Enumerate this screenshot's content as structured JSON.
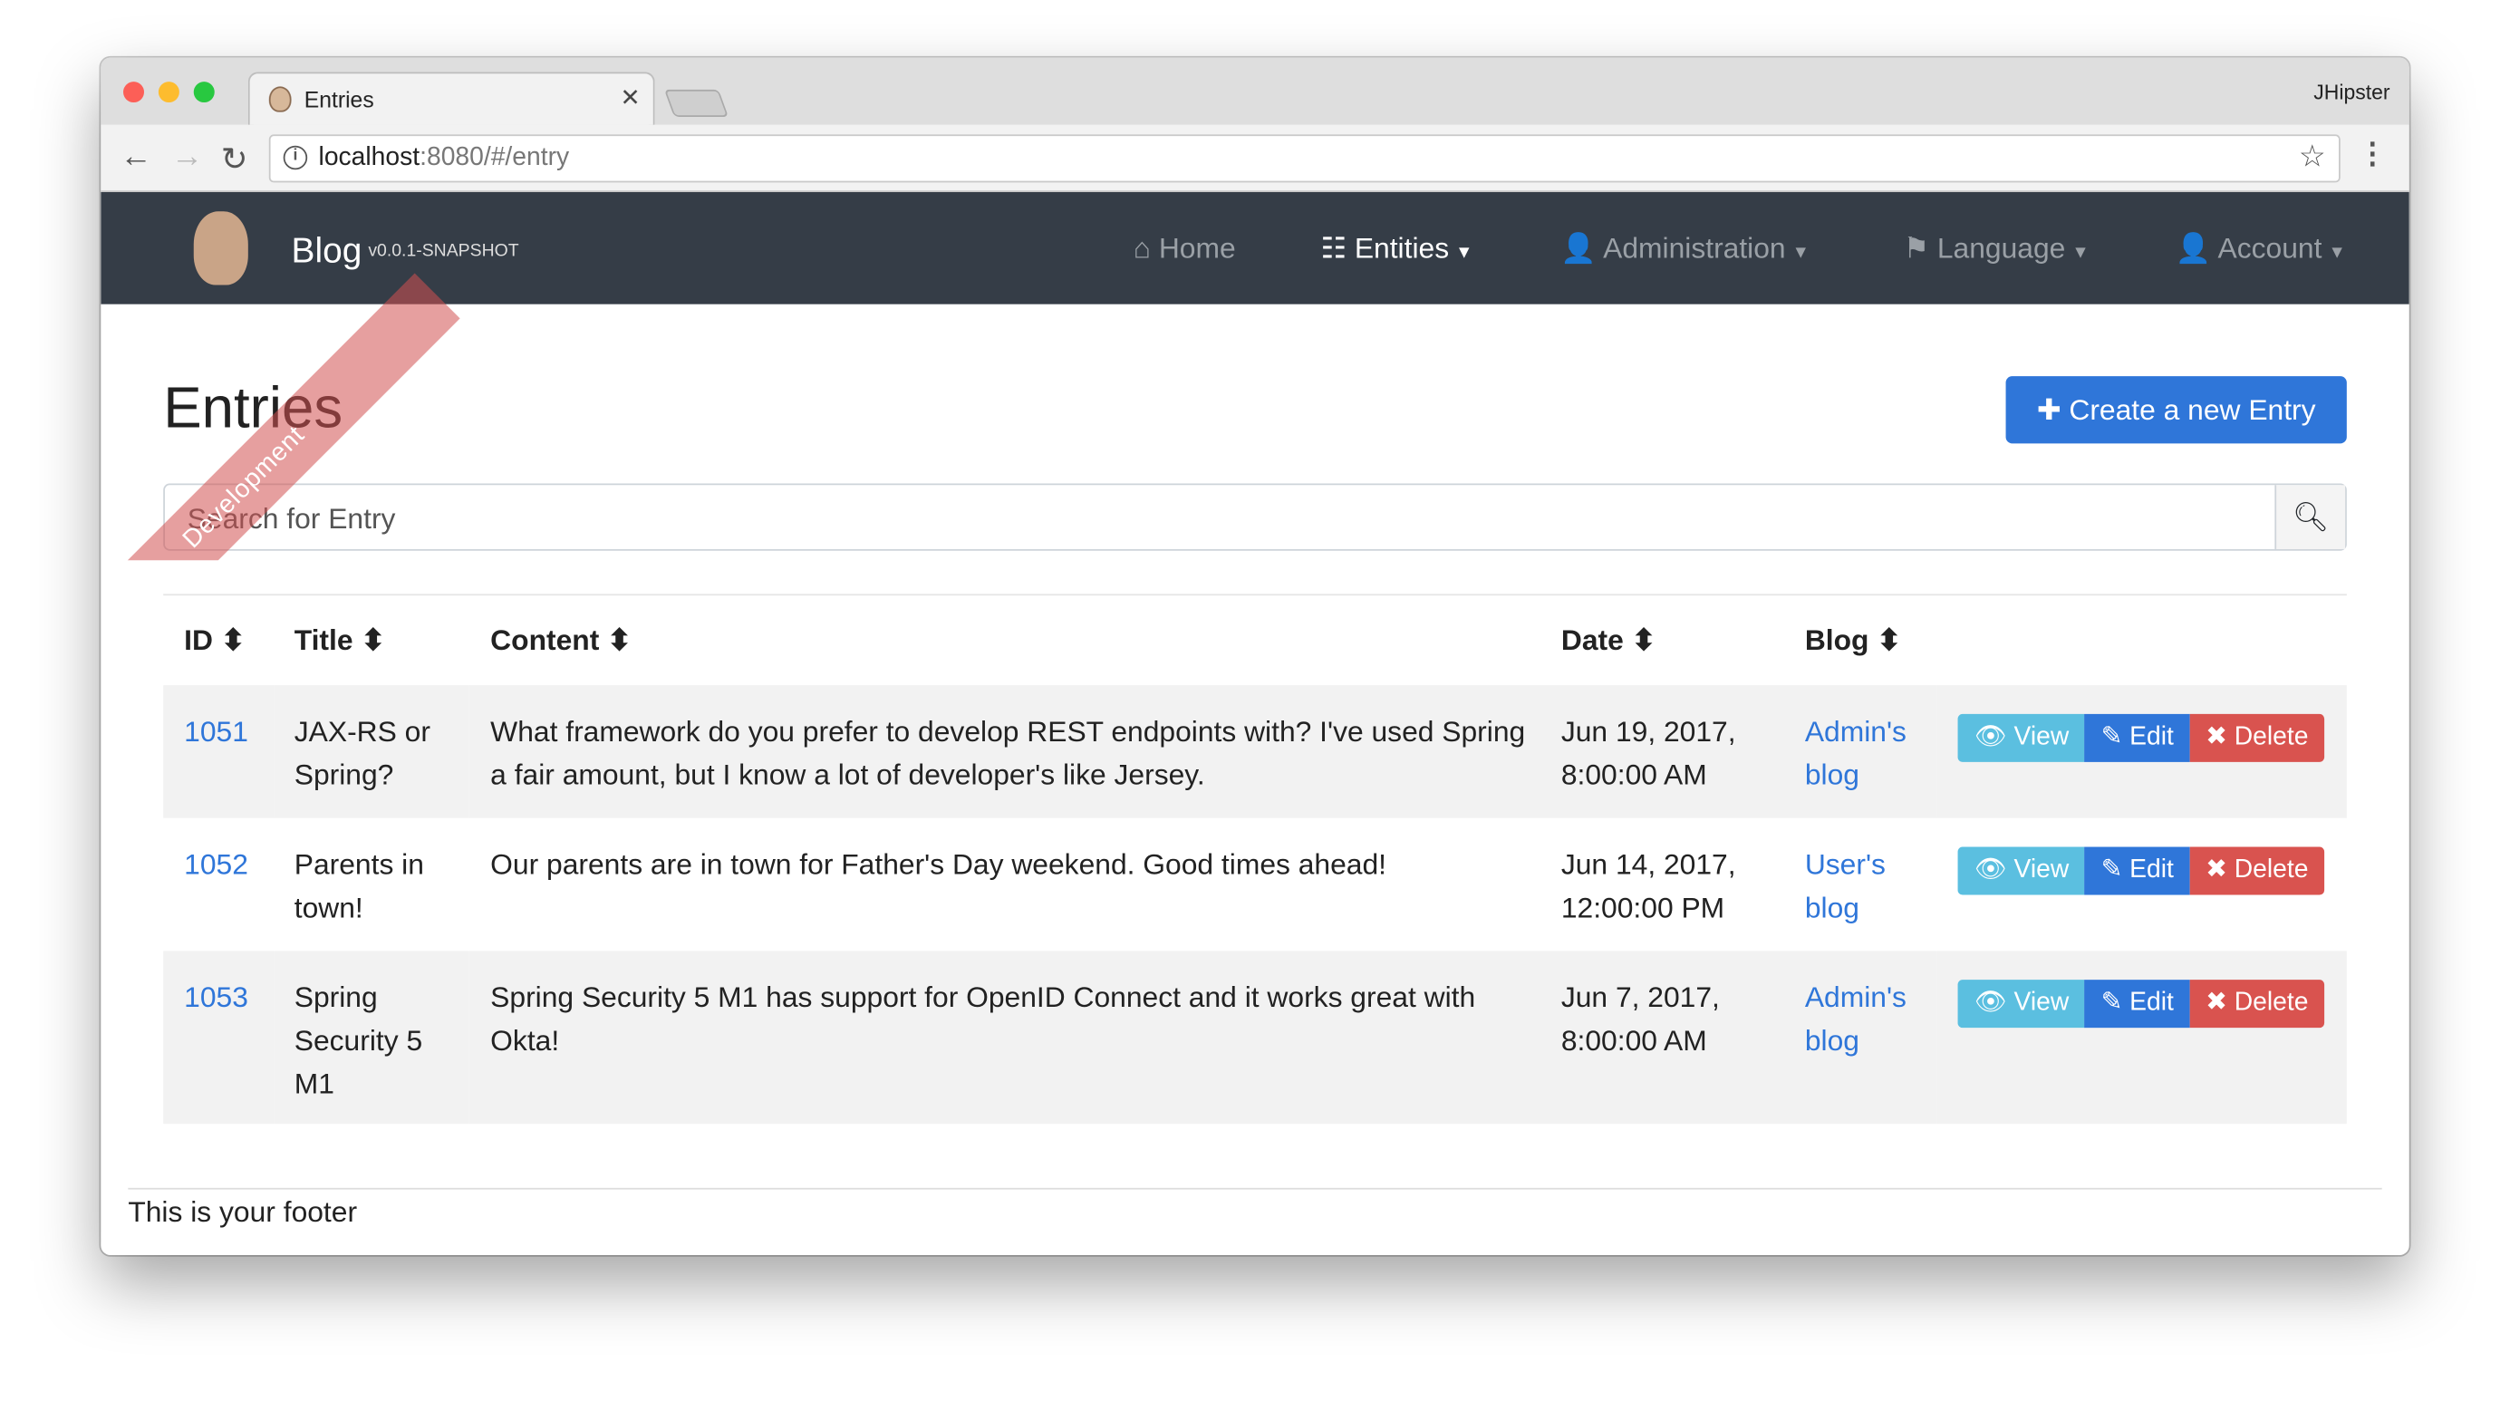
{
  "browser": {
    "tab_title": "Entries",
    "profile": "JHipster",
    "url_host": "localhost",
    "url_rest": ":8080/#/entry"
  },
  "navbar": {
    "brand": "Blog",
    "version": "v0.0.1-SNAPSHOT",
    "ribbon": "Development",
    "items": [
      {
        "label": "Home"
      },
      {
        "label": "Entities"
      },
      {
        "label": "Administration"
      },
      {
        "label": "Language"
      },
      {
        "label": "Account"
      }
    ]
  },
  "page": {
    "title": "Entries",
    "create_label": "Create a new Entry",
    "search_placeholder": "Search for Entry"
  },
  "table": {
    "headers": [
      "ID",
      "Title",
      "Content",
      "Date",
      "Blog"
    ],
    "rows": [
      {
        "id": "1051",
        "title": "JAX-RS or Spring?",
        "content": "What framework do you prefer to develop REST endpoints with? I've used Spring a fair amount, but I know a lot of developer's like Jersey.",
        "date": "Jun 19, 2017, 8:00:00 AM",
        "blog": "Admin's blog"
      },
      {
        "id": "1052",
        "title": "Parents in town!",
        "content": "Our parents are in town for Father's Day weekend. Good times ahead!",
        "date": "Jun 14, 2017, 12:00:00 PM",
        "blog": "User's blog"
      },
      {
        "id": "1053",
        "title": "Spring Security 5 M1",
        "content": "Spring Security 5 M1 has support for OpenID Connect and it works great with Okta!",
        "date": "Jun 7, 2017, 8:00:00 AM",
        "blog": "Admin's blog"
      }
    ],
    "actions": {
      "view": "View",
      "edit": "Edit",
      "delete": "Delete"
    }
  },
  "footer": {
    "text": "This is your footer"
  },
  "colors": {
    "primary": "#2f76d9",
    "info": "#5bbfe0",
    "danger": "#d9534f",
    "navbar": "#353d47"
  }
}
